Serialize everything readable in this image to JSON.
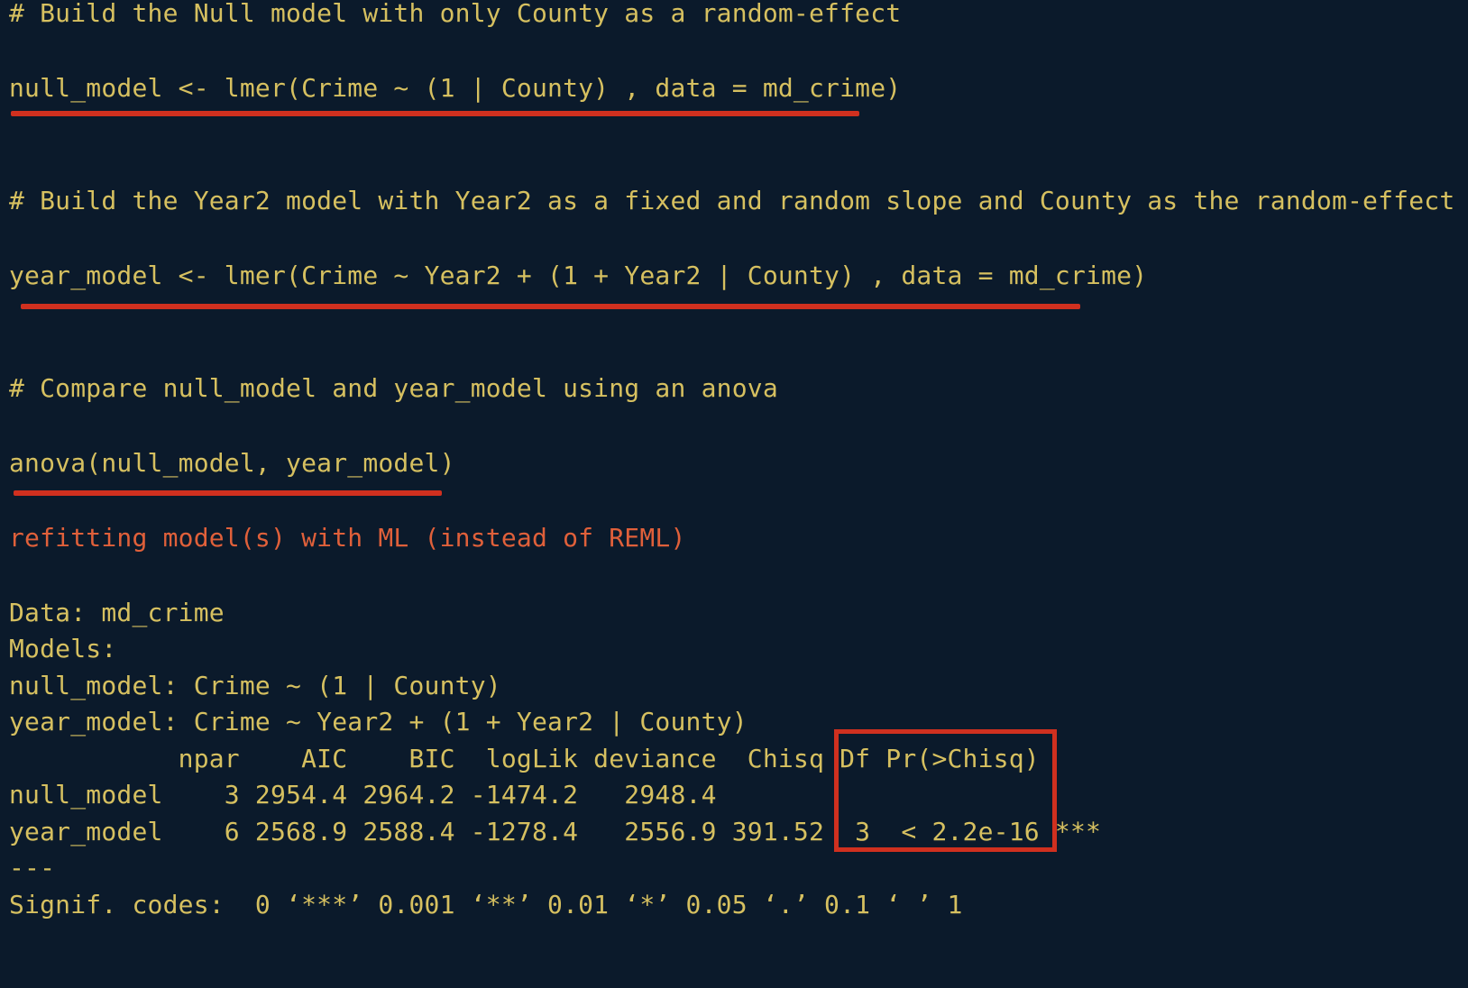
{
  "colors": {
    "background": "#0b1a2b",
    "code_text": "#d6c060",
    "message_text": "#e0603a",
    "annotation": "#d0301f"
  },
  "lines": {
    "comment1": "# Build the Null model with only County as a random-effect",
    "code1": "null_model <- lmer(Crime ~ (1 | County) , data = md_crime)",
    "comment2": "# Build the Year2 model with Year2 as a fixed and random slope and County as the random-effect",
    "code2": "year_model <- lmer(Crime ~ Year2 + (1 + Year2 | County) , data = md_crime)",
    "comment3": "# Compare null_model and year_model using an anova",
    "code3": "anova(null_model, year_model)",
    "message": "refitting model(s) with ML (instead of REML)",
    "data_line": "Data: md_crime",
    "models_label": "Models:",
    "null_formula": "null_model: Crime ~ (1 | County)",
    "year_formula": "year_model: Crime ~ Year2 + (1 + Year2 | County)",
    "table_header": "           npar    AIC    BIC  logLik deviance  Chisq Df Pr(>Chisq)",
    "table_row_null": "null_model    3 2954.4 2964.2 -1474.2   2948.4",
    "table_row_year": "year_model    6 2568.9 2588.4 -1278.4   2556.9 391.52  3  < 2.2e-16 ***",
    "separator": "---",
    "signif": "Signif. codes:  0 ‘***’ 0.001 ‘**’ 0.01 ‘*’ 0.05 ‘.’ 0.1 ‘ ’ 1"
  }
}
